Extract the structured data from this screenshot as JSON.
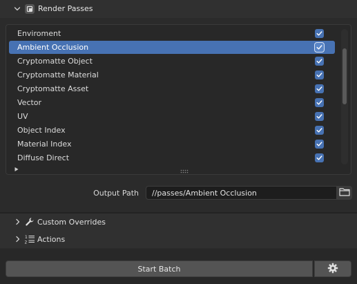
{
  "render_passes_panel": {
    "title": "Render Passes",
    "collapse_icon": "chevron-down-icon",
    "header_icon": "render-passes-checkbox-icon"
  },
  "passes": {
    "items": [
      {
        "label": "Enviroment",
        "checked": true,
        "active": false
      },
      {
        "label": "Ambient Occlusion",
        "checked": true,
        "active": true
      },
      {
        "label": "Cryptomatte Object",
        "checked": true,
        "active": false
      },
      {
        "label": "Cryptomatte Material",
        "checked": true,
        "active": false
      },
      {
        "label": "Cryptomatte Asset",
        "checked": true,
        "active": false
      },
      {
        "label": "Vector",
        "checked": true,
        "active": false
      },
      {
        "label": "UV",
        "checked": true,
        "active": false
      },
      {
        "label": "Object Index",
        "checked": true,
        "active": false
      },
      {
        "label": "Material Index",
        "checked": true,
        "active": false
      },
      {
        "label": "Diffuse Direct",
        "checked": true,
        "active": false
      }
    ]
  },
  "output": {
    "label": "Output Path",
    "value": "//passes/Ambient Occlusion",
    "browse_icon": "folder-icon"
  },
  "custom_overrides": {
    "label": "Custom Overrides",
    "icon": "wrench-icon",
    "expand_icon": "chevron-right-icon"
  },
  "actions": {
    "label": "Actions",
    "icon": "numbered-list-icon",
    "expand_icon": "chevron-right-icon"
  },
  "footer": {
    "start_label": "Start Batch",
    "settings_icon": "gear-icon"
  },
  "colors": {
    "accent": "#4772b3",
    "background": "#2b2b2b",
    "list_background": "#282828"
  }
}
